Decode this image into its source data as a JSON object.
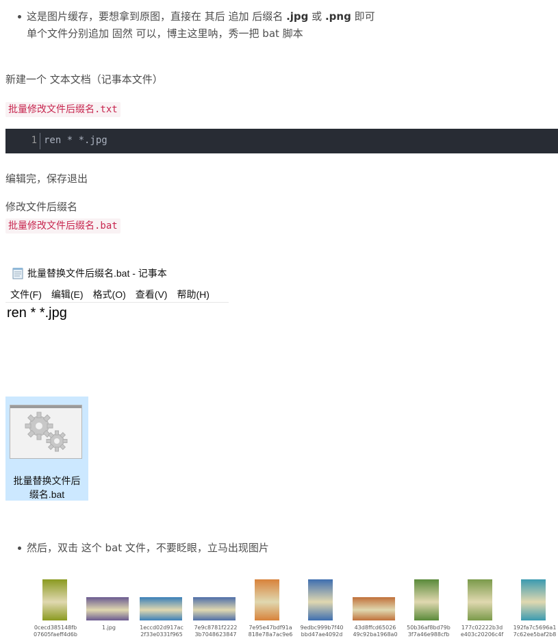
{
  "bullet1": {
    "line1_a": "这是图片缓存，要想拿到原图，直接在 其后 追加 后缀名 ",
    "jpg": ".jpg",
    "or": " 或 ",
    "png": ".png",
    "line1_b": " 即可",
    "line2": "单个文件分别追加 固然 可以，博主这里呐，秀一把 bat 脚本"
  },
  "para_new_doc": "新建一个 文本文档（记事本文件）",
  "code_txt_name": "批量修改文件后缀名.txt",
  "code_block": {
    "line_no": "1",
    "code": "ren * *.jpg"
  },
  "para_edit_done": "编辑完，保存退出",
  "para_rename_ext": "修改文件后缀名",
  "code_bat_name": "批量修改文件后缀名.bat",
  "notepad": {
    "title": "批量替换文件后缀名.bat - 记事本",
    "menu": [
      "文件(F)",
      "编辑(E)",
      "格式(O)",
      "查看(V)",
      "帮助(H)"
    ],
    "content": "ren * *.jpg"
  },
  "file_tile": {
    "name_line1": "批量替换文件后",
    "name_line2": "缀名.bat",
    "icon": "gear-icon"
  },
  "bullet2": "然后，双击 这个 bat 文件，不要眨眼，立马出现图片",
  "thumbnails": [
    {
      "line1": "0cecd385148fb",
      "line2": "07605faeff4d6b",
      "color": "#8a9a20"
    },
    {
      "line1": "1.jpg",
      "line2": "",
      "color": "#6a5a90"
    },
    {
      "line1": "1eccd02d917ac",
      "line2": "2f33e0331f965",
      "color": "#3a7fb8"
    },
    {
      "line1": "7e9c8781f2222",
      "line2": "3b7048623847",
      "color": "#4e6ea8"
    },
    {
      "line1": "7e95e47bdf91a",
      "line2": "818e78a7ac9e6",
      "color": "#d8823a"
    },
    {
      "line1": "9edbc999b7f40",
      "line2": "bbd47ae4092d",
      "color": "#3e6eb0"
    },
    {
      "line1": "43d8ffcd65026",
      "line2": "49c92ba1968a0",
      "color": "#c0703a"
    },
    {
      "line1": "50b36af8bd79b",
      "line2": "3f7a46e988cfb",
      "color": "#5a8a3a"
    },
    {
      "line1": "177c02222b3d",
      "line2": "e403c20206c4f",
      "color": "#7a9a4a"
    },
    {
      "line1": "192fa7c5696a1",
      "line2": "7c62ee5baf2b8",
      "color": "#3a9ab0"
    }
  ]
}
